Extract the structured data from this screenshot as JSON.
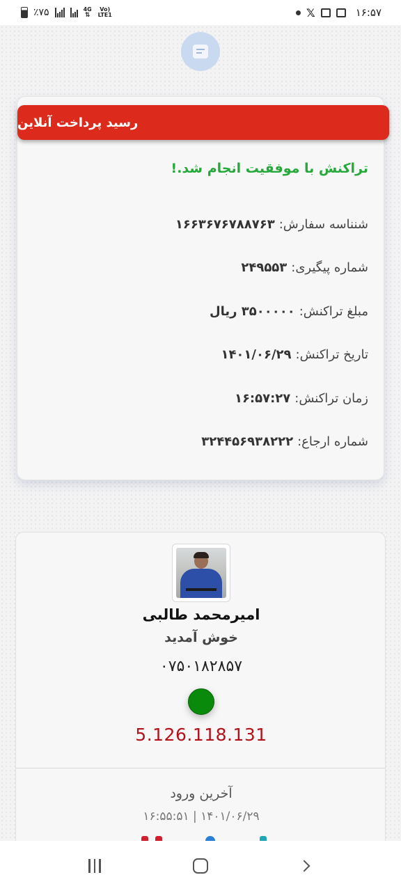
{
  "status_bar": {
    "battery": "٪۷۵",
    "network_top": "4G",
    "network_bottom": "Vo) LTE1",
    "time": "۱۶:۵۷",
    "icons": [
      "battery-icon",
      "signal-icon",
      "signal-icon",
      "network-icon",
      "dot-icon",
      "x-icon",
      "gallery-icon",
      "news-icon"
    ]
  },
  "top_icon": "receipt-icon",
  "receipt": {
    "title": "رسید پرداخت آنلاین",
    "success_message": "تراکنش با موفقیت انجام شد.!",
    "rows": [
      {
        "label": "شنناسه سفارش:",
        "value": "۱۶۶۳۶۷۶۷۸۸۷۶۳"
      },
      {
        "label": "شماره پیگیری:",
        "value": "۲۴۹۵۵۳"
      },
      {
        "label": "مبلغ تراکنش:",
        "value": "۳۵۰۰۰۰۰ ریال"
      },
      {
        "label": "تاریخ تراکنش:",
        "value": "۱۴۰۱/۰۶/۲۹"
      },
      {
        "label": "زمان تراکنش:",
        "value": "۱۶:۵۷:۲۷"
      },
      {
        "label": "شماره ارجاع:",
        "value": "۳۲۴۴۵۶۹۳۸۲۲۲"
      }
    ]
  },
  "profile": {
    "name": "امیرمحمد طالبی",
    "welcome": "خوش آمدید",
    "code": "۰۷۵۰۱۸۲۸۵۷",
    "status_color": "#0a8a0a",
    "ip": "5.126.118.131",
    "last_login_label": "آخرین ورود",
    "last_login_value": "۱۶:۵۵:۵۱ | ۱۴۰۱/۰۶/۲۹"
  },
  "colors": {
    "header_red": "#dc2a1d",
    "success_green": "#26a83a",
    "ip_red": "#b3121a",
    "badge_blue": "#c9d9f0"
  }
}
